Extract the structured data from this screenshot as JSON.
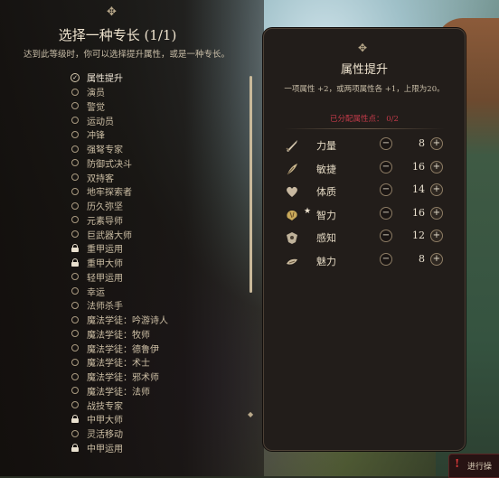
{
  "left_panel": {
    "title": "选择一种专长 (1/1)",
    "description": "达到此等级时，你可以选择提升属性，或是一种专长。",
    "feats": [
      {
        "label": "属性提升",
        "state": "selected"
      },
      {
        "label": "演员",
        "state": "available"
      },
      {
        "label": "警觉",
        "state": "available"
      },
      {
        "label": "运动员",
        "state": "available"
      },
      {
        "label": "冲锋",
        "state": "available"
      },
      {
        "label": "强弩专家",
        "state": "available"
      },
      {
        "label": "防御式决斗",
        "state": "available"
      },
      {
        "label": "双持客",
        "state": "available"
      },
      {
        "label": "地牢探索者",
        "state": "available"
      },
      {
        "label": "历久弥坚",
        "state": "available"
      },
      {
        "label": "元素导师",
        "state": "available"
      },
      {
        "label": "巨武器大师",
        "state": "available"
      },
      {
        "label": "重甲运用",
        "state": "locked"
      },
      {
        "label": "重甲大师",
        "state": "locked"
      },
      {
        "label": "轻甲运用",
        "state": "available"
      },
      {
        "label": "幸运",
        "state": "available"
      },
      {
        "label": "法师杀手",
        "state": "available"
      },
      {
        "label": "魔法学徒：吟游诗人",
        "state": "available"
      },
      {
        "label": "魔法学徒：牧师",
        "state": "available"
      },
      {
        "label": "魔法学徒：德鲁伊",
        "state": "available"
      },
      {
        "label": "魔法学徒：术士",
        "state": "available"
      },
      {
        "label": "魔法学徒：邪术师",
        "state": "available"
      },
      {
        "label": "魔法学徒：法师",
        "state": "available"
      },
      {
        "label": "战技专家",
        "state": "available"
      },
      {
        "label": "中甲大师",
        "state": "locked"
      },
      {
        "label": "灵活移动",
        "state": "available"
      },
      {
        "label": "中甲运用",
        "state": "locked"
      }
    ]
  },
  "right_panel": {
    "title": "属性提升",
    "description": "一项属性 +2，或两项属性各 +1，上限为20。",
    "allocated_label": "已分配属性点： 0/2",
    "stats": [
      {
        "name": "力量",
        "value": "8",
        "icon": "sword-icon",
        "starred": false,
        "plus": "+"
      },
      {
        "name": "敏捷",
        "value": "16",
        "icon": "feather-icon",
        "starred": false,
        "plus": "+"
      },
      {
        "name": "体质",
        "value": "14",
        "icon": "heart-icon",
        "starred": false,
        "plus": "+"
      },
      {
        "name": "智力",
        "value": "16",
        "icon": "brain-icon",
        "starred": true,
        "plus": "+"
      },
      {
        "name": "感知",
        "value": "12",
        "icon": "eye-icon",
        "starred": false,
        "plus": "+"
      },
      {
        "name": "魅力",
        "value": "8",
        "icon": "mask-icon",
        "starred": false,
        "plus": "+"
      }
    ],
    "minus_symbol": "−",
    "star_symbol": "★"
  },
  "warning": {
    "text": "进行操"
  },
  "colors": {
    "accent_gold": "#c9b99a",
    "alloc_red": "#c23a49"
  }
}
